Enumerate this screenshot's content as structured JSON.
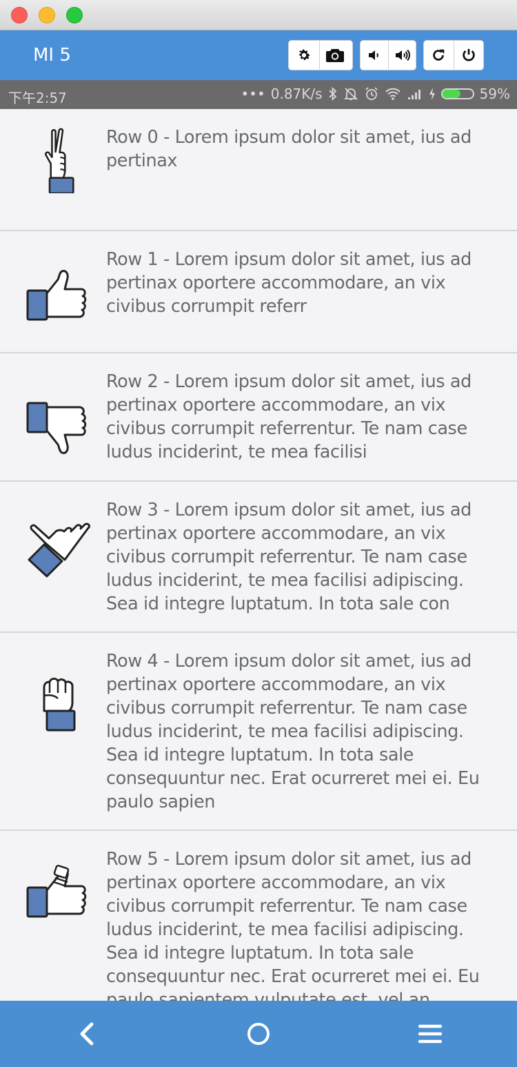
{
  "window": {
    "title": ""
  },
  "toolbar": {
    "device_name": "MI 5",
    "buttons": [
      {
        "name": "settings",
        "icon": "gear-icon"
      },
      {
        "name": "screenshot",
        "icon": "camera-icon"
      },
      {
        "name": "volume-down",
        "icon": "volume-down-icon"
      },
      {
        "name": "volume-up",
        "icon": "volume-up-icon"
      },
      {
        "name": "rotate",
        "icon": "rotate-icon"
      },
      {
        "name": "power",
        "icon": "power-icon"
      }
    ]
  },
  "status_bar": {
    "time": "下午2:57",
    "dots": "•••",
    "speed": "0.87K/s",
    "battery_percent": "59%",
    "battery_level": 0.59,
    "battery_color": "#4cd94c"
  },
  "rows": [
    {
      "text": "Row 0 - Lorem ipsum dolor sit amet, ius ad pertinax",
      "icon": "peace-hand-icon"
    },
    {
      "text": "Row 1 - Lorem ipsum dolor sit amet, ius ad pertinax oportere accommodare, an vix civibus corrumpit referr",
      "icon": "thumbs-up-icon"
    },
    {
      "text": "Row 2 - Lorem ipsum dolor sit amet, ius ad pertinax oportere accommodare, an vix civibus corrumpit referrentur. Te nam case ludus inciderint, te mea facilisi",
      "icon": "thumbs-down-icon"
    },
    {
      "text": "Row 3 - Lorem ipsum dolor sit amet, ius ad pertinax oportere accommodare, an vix civibus corrumpit referrentur. Te nam case ludus inciderint, te mea facilisi adipiscing. Sea id integre luptatum. In tota sale con",
      "icon": "shaka-hand-icon"
    },
    {
      "text": "Row 4 - Lorem ipsum dolor sit amet, ius ad pertinax oportere accommodare, an vix civibus corrumpit referrentur. Te nam case ludus inciderint, te mea facilisi adipiscing. Sea id integre luptatum. In tota sale consequuntur nec. Erat ocurreret mei ei. Eu paulo sapien",
      "icon": "fist-icon"
    },
    {
      "text": "Row 5 - Lorem ipsum dolor sit amet, ius ad pertinax oportere accommodare, an vix civibus corrumpit referrentur. Te nam case ludus inciderint, te mea facilisi adipiscing. Sea id integre luptatum. In tota sale consequuntur nec. Erat ocurreret mei ei. Eu paulo sapientem vulputate est, vel an",
      "icon": "bandaged-thumbs-up-icon"
    }
  ],
  "nav": {
    "back_icon": "back-chevron-icon",
    "home_icon": "home-circle-icon",
    "menu_icon": "menu-icon"
  },
  "colors": {
    "toolbar": "#4a90d9",
    "navbar": "#4a8fd2",
    "status_bar": "#6a6a6a",
    "icon_sleeve": "#5b7fb8"
  }
}
